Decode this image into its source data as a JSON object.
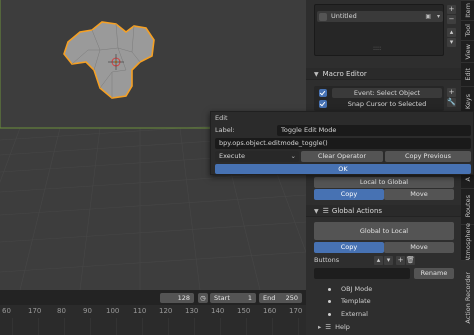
{
  "viewport": {
    "grid_color": "#4a4a4a",
    "axis_color_x": "#8bb04a",
    "selection_outline": "#f5a024"
  },
  "timeline": {
    "current_frame": "128",
    "start_label": "Start",
    "start_value": "1",
    "end_label": "End",
    "end_value": "250",
    "ticks": [
      "60",
      "170",
      "80",
      "90",
      "100",
      "110",
      "120",
      "130",
      "140",
      "150",
      "160",
      "170"
    ]
  },
  "npanel": {
    "list": {
      "item_label": "Untitled"
    },
    "macro_editor": {
      "title": "Macro Editor",
      "actions": [
        {
          "label": "Event: Select Object",
          "checked": true
        },
        {
          "label": "Snap Cursor to Selected",
          "checked": true
        }
      ]
    },
    "local_actions": {
      "local_to_global": "Local to Global",
      "copy": "Copy",
      "move": "Move"
    },
    "global_actions": {
      "title": "Global Actions",
      "global_to_local": "Global to Local",
      "copy": "Copy",
      "move": "Move"
    },
    "buttons": {
      "label": "Buttons",
      "rename": "Rename",
      "tree": [
        "OBJ Mode",
        "Template",
        "External",
        "Help"
      ]
    }
  },
  "tabs": [
    "Item",
    "Tool",
    "View",
    "Edit",
    "Keys",
    "A",
    "Routes",
    "Atmosphere",
    "Action Recorder"
  ],
  "edit_popup": {
    "title": "Edit",
    "label_caption": "Label:",
    "label_value": "Toggle Edit Mode",
    "command": "bpy.ops.object.editmode_toggle()",
    "execute_option": "Execute",
    "clear_button": "Clear Operator Command",
    "copy_previous_button": "Copy Previous",
    "ok_button": "OK"
  },
  "accent": "#4772b3"
}
